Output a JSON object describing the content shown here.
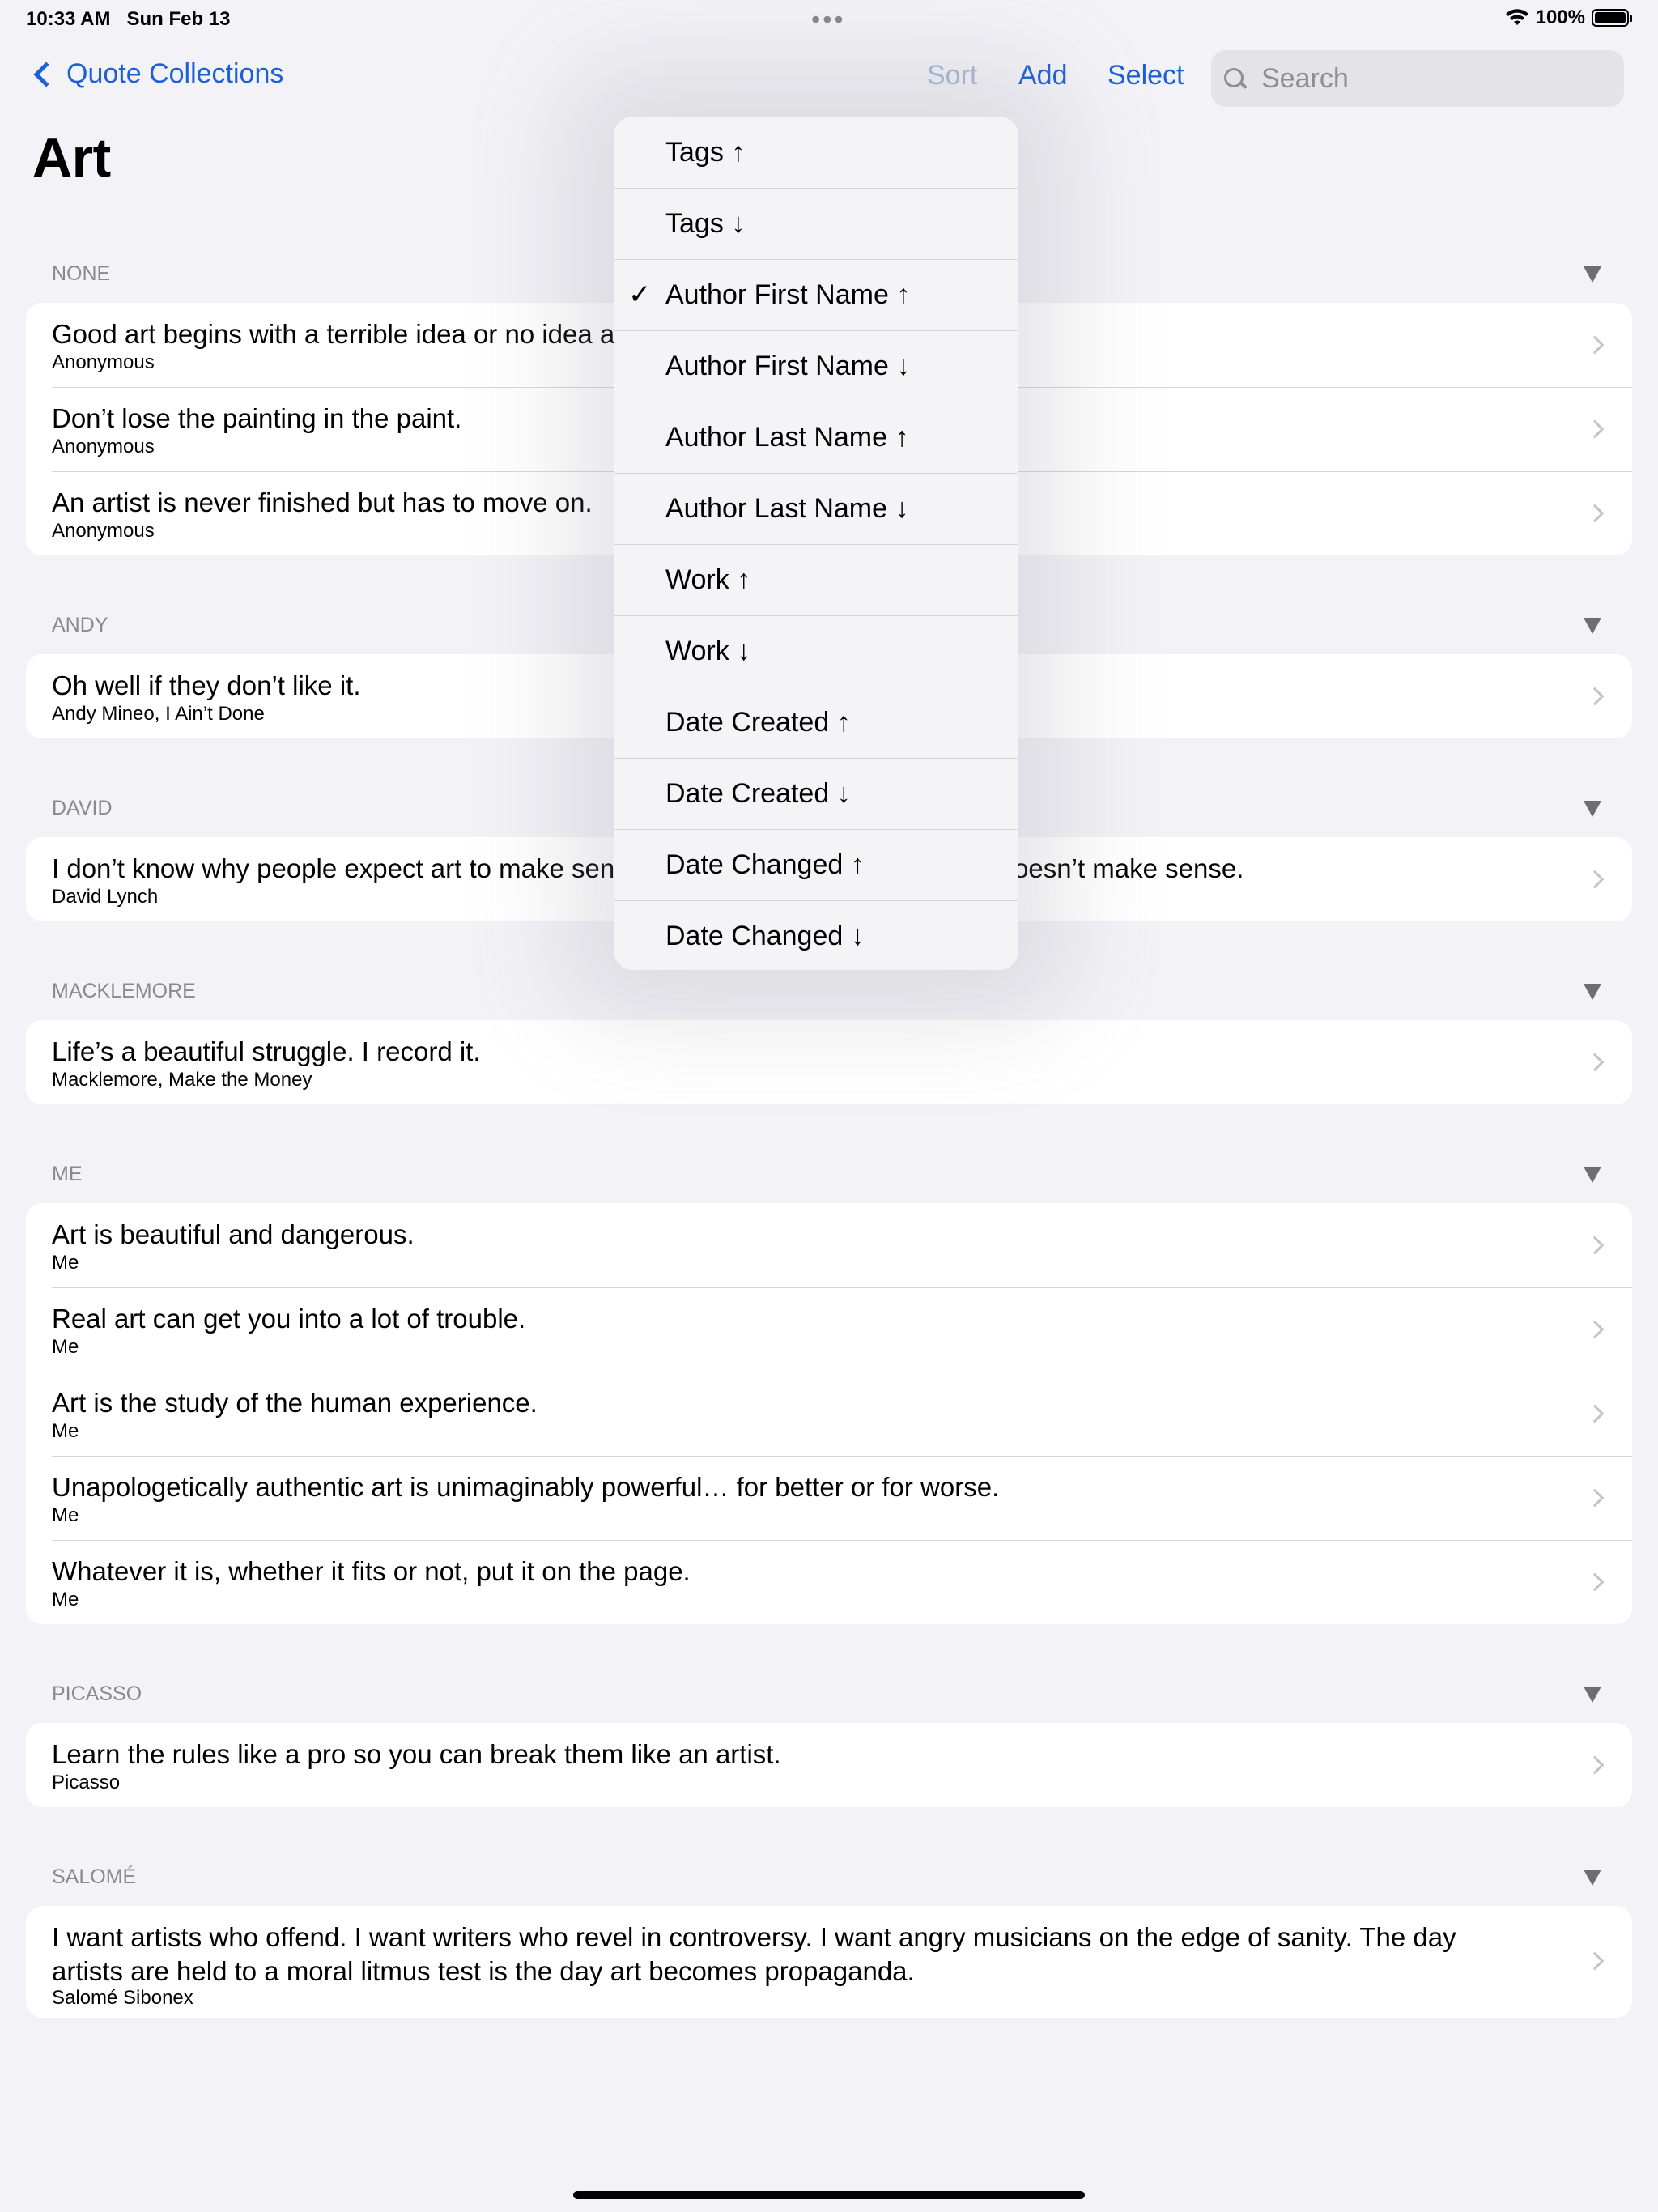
{
  "status_bar": {
    "time": "10:33 AM",
    "date": "Sun Feb 13",
    "battery": "100%",
    "battery_level": 1.0,
    "wifi_icon": "wifi-icon",
    "battery_icon": "battery-icon"
  },
  "nav": {
    "back_label": "Quote Collections",
    "sort_label": "Sort",
    "add_label": "Add",
    "select_label": "Select",
    "search_placeholder": "Search",
    "accent_color": "#1c5fd6"
  },
  "page_title": "Art",
  "sections": [
    {
      "header": "NONE",
      "rows": [
        {
          "text": "Good art begins with a terrible idea or no idea at all.",
          "sub": "Anonymous"
        },
        {
          "text": "Don’t lose the painting in the paint.",
          "sub": "Anonymous"
        },
        {
          "text": "An artist is never finished but has to move on.",
          "sub": "Anonymous"
        }
      ]
    },
    {
      "header": "ANDY",
      "rows": [
        {
          "text": "Oh well if they don’t like it.",
          "sub": "Andy Mineo, I Ain’t Done"
        }
      ]
    },
    {
      "header": "DAVID",
      "rows": [
        {
          "text": "I don’t know why people expect art to make sense. They accept the fact that life doesn’t make sense.",
          "sub": "David Lynch"
        }
      ]
    },
    {
      "header": "MACKLEMORE",
      "rows": [
        {
          "text": "Life’s a beautiful struggle. I record it.",
          "sub": "Macklemore, Make the Money"
        }
      ]
    },
    {
      "header": "ME",
      "rows": [
        {
          "text": "Art is beautiful and dangerous.",
          "sub": "Me"
        },
        {
          "text": "Real art can get you into a lot of trouble.",
          "sub": "Me"
        },
        {
          "text": "Art is the study of the human experience.",
          "sub": "Me"
        },
        {
          "text": "Unapologetically authentic art is unimaginably powerful… for better or for worse.",
          "sub": "Me"
        },
        {
          "text": "Whatever it is, whether it fits or not, put it on the page.",
          "sub": "Me"
        }
      ]
    },
    {
      "header": "PICASSO",
      "rows": [
        {
          "text": "Learn the rules like a pro so you can break them like an artist.",
          "sub": "Picasso"
        }
      ]
    },
    {
      "header": "SALOMÉ",
      "rows": [
        {
          "text": "I want artists who offend. I want writers who revel in controversy. I want angry musicians on the edge of sanity. The day artists are held to a moral litmus test is the day art becomes propaganda.",
          "sub": "Salomé Sibonex"
        }
      ]
    }
  ],
  "sort_menu": {
    "checkmark": "✓",
    "items": [
      {
        "label": "Tags ↑",
        "checked": false
      },
      {
        "label": "Tags ↓",
        "checked": false
      },
      {
        "label": "Author First Name ↑",
        "checked": true
      },
      {
        "label": "Author First Name ↓",
        "checked": false
      },
      {
        "label": "Author Last Name ↑",
        "checked": false
      },
      {
        "label": "Author Last Name ↓",
        "checked": false
      },
      {
        "label": "Work ↑",
        "checked": false
      },
      {
        "label": "Work ↓",
        "checked": false
      },
      {
        "label": "Date Created ↑",
        "checked": false
      },
      {
        "label": "Date Created ↓",
        "checked": false
      },
      {
        "label": "Date Changed ↑",
        "checked": false
      },
      {
        "label": "Date Changed ↓",
        "checked": false
      }
    ]
  }
}
